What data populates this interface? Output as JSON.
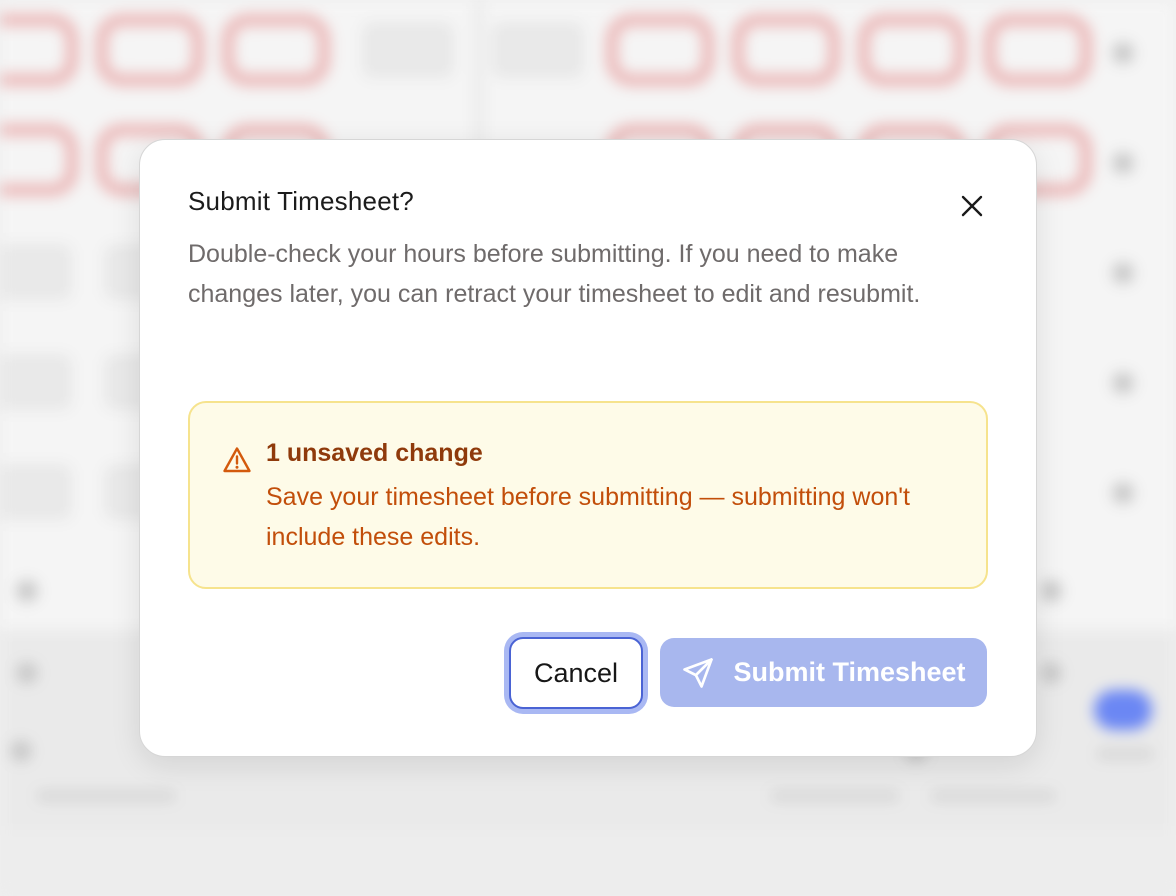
{
  "dialog": {
    "title": "Submit Timesheet?",
    "description": "Double-check your hours before submitting. If you need to make changes later, you can retract your timesheet to edit and resubmit.",
    "close_icon": "close-icon",
    "alert": {
      "icon": "warning-triangle-icon",
      "title": "1 unsaved change",
      "body": "Save your timesheet before submitting — submitting won't include these edits.",
      "background": "#fefbe8",
      "border": "#f6e38d",
      "title_color": "#8f3a0b",
      "body_color": "#c24e0a"
    },
    "buttons": {
      "cancel_label": "Cancel",
      "submit_label": "Submit Timesheet",
      "submit_icon": "send-icon",
      "submit_color": "#a8b7ee",
      "cancel_focus_color": "#4a63d4"
    }
  }
}
